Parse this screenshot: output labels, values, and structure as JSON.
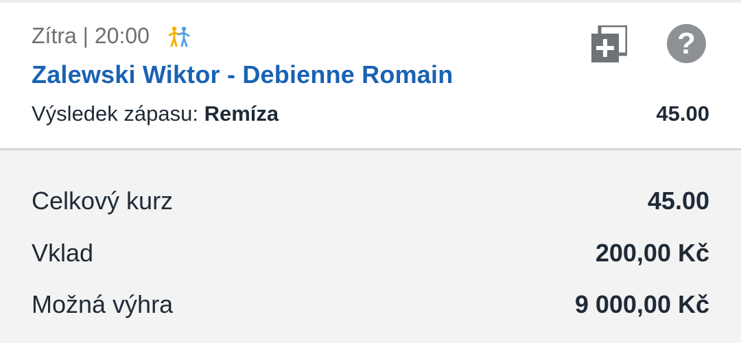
{
  "bet": {
    "date_time": "Zítra | 20:00",
    "sport_icon": "fighting-sport-icon",
    "match": "Zalewski Wiktor - Debienne Romain",
    "market_label": "Výsledek zápasu:",
    "pick": "Remíza",
    "odds": "45.00",
    "add_icon": "add-copy-icon",
    "help_icon": "help-icon",
    "help_glyph": "?"
  },
  "summary": {
    "total_odds_label": "Celkový kurz",
    "total_odds_value": "45.00",
    "stake_label": "Vklad",
    "stake_value": "200,00 Kč",
    "win_label": "Možná výhra",
    "win_value": "9 000,00 Kč"
  },
  "colors": {
    "accent": "#1a62b4",
    "text": "#1f2a36",
    "muted": "#6e6e6e",
    "icon_gray": "#8d9196",
    "sport_icon": "#f4b000",
    "background": "#f3f3f3"
  }
}
